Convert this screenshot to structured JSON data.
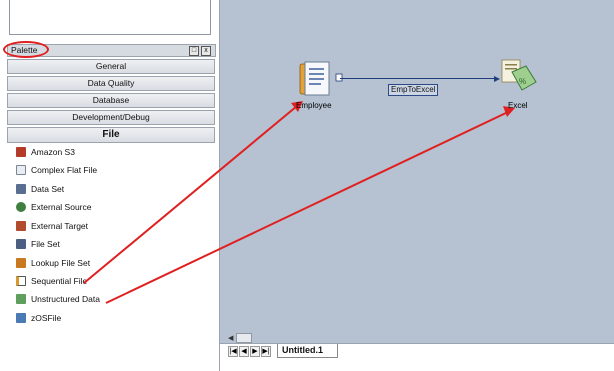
{
  "palette": {
    "title": "Palette",
    "header_buttons": [
      "□",
      "x"
    ],
    "categories": [
      "General",
      "Data Quality",
      "Database",
      "Development/Debug",
      "File"
    ],
    "items": [
      {
        "label": "Amazon S3",
        "icon": "amazon-s3-icon",
        "color": "#b43a2a"
      },
      {
        "label": "Complex Flat File",
        "icon": "complex-flat-file-icon",
        "color": "#7a8696"
      },
      {
        "label": "Data Set",
        "icon": "data-set-icon",
        "color": "#5a6f8f"
      },
      {
        "label": "External Source",
        "icon": "external-source-icon",
        "color": "#3f7f3f"
      },
      {
        "label": "External Target",
        "icon": "external-target-icon",
        "color": "#b24a2e"
      },
      {
        "label": "File Set",
        "icon": "file-set-icon",
        "color": "#4d5f80"
      },
      {
        "label": "Lookup File Set",
        "icon": "lookup-file-set-icon",
        "color": "#c97a21"
      },
      {
        "label": "Sequential File",
        "icon": "sequential-file-icon",
        "color": "#d99a2b"
      },
      {
        "label": "Unstructured Data",
        "icon": "unstructured-data-icon",
        "color": "#5e9f5e"
      },
      {
        "label": "zOSFile",
        "icon": "zos-file-icon",
        "color": "#4b79b3"
      }
    ]
  },
  "canvas": {
    "stages": {
      "employee": "Employee",
      "excel": "Excel"
    },
    "link_label": "EmpToExcel"
  },
  "tabs": {
    "document": "Untitled.1"
  },
  "nav_buttons": [
    "|◀",
    "◀",
    "▶",
    "▶|"
  ],
  "scroll_arrow": "◀",
  "colors": {
    "annotation": "#e02020",
    "canvas": "#b6c2d1",
    "link": "#1f3d7a"
  }
}
